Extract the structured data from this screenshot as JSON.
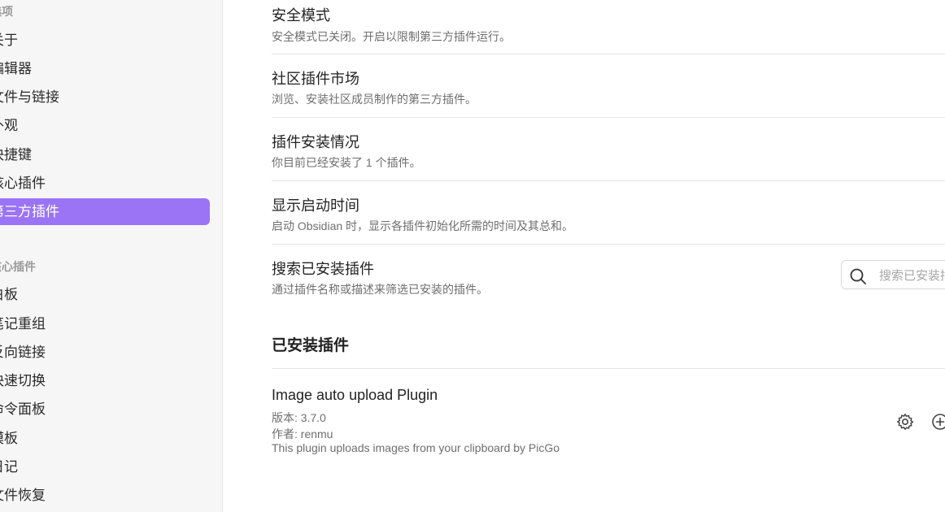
{
  "sidebar": {
    "group_options_title": "选项",
    "options": [
      {
        "label": "关于"
      },
      {
        "label": "编辑器"
      },
      {
        "label": "文件与链接"
      },
      {
        "label": "外观"
      },
      {
        "label": "快捷键"
      },
      {
        "label": "核心插件"
      },
      {
        "label": "第三方插件",
        "active": true
      }
    ],
    "group_core_title": "核心插件",
    "core_plugins": [
      {
        "label": "白板"
      },
      {
        "label": "笔记重组"
      },
      {
        "label": "反向链接"
      },
      {
        "label": "快速切换"
      },
      {
        "label": "命令面板"
      },
      {
        "label": "模板"
      },
      {
        "label": "日记"
      },
      {
        "label": "文件恢复"
      }
    ]
  },
  "settings": [
    {
      "name": "安全模式",
      "desc": "安全模式已关闭。开启以限制第三方插件运行。"
    },
    {
      "name": "社区插件市场",
      "desc": "浏览、安装社区成员制作的第三方插件。"
    },
    {
      "name": "插件安装情况",
      "desc": "你目前已经安装了 1 个插件。"
    },
    {
      "name": "显示启动时间",
      "desc": "启动 Obsidian 时，显示各插件初始化所需的时间及其总和。"
    },
    {
      "name": "搜索已安装插件",
      "desc": "通过插件名称或描述来筛选已安装的插件。"
    }
  ],
  "search": {
    "placeholder": "搜索已安装插件..."
  },
  "installed": {
    "heading": "已安装插件",
    "plugins": [
      {
        "name": "Image auto upload Plugin",
        "version": "版本: 3.7.0",
        "author": "作者:  renmu",
        "description": "This plugin uploads images from your clipboard by PicGo"
      }
    ]
  },
  "icons": {
    "search": "search-icon",
    "settings": "gear-icon",
    "hotkey": "plus-circle-icon"
  },
  "colors": {
    "accent": "#9b74f5",
    "sidebar_bg": "#f6f6f6"
  }
}
